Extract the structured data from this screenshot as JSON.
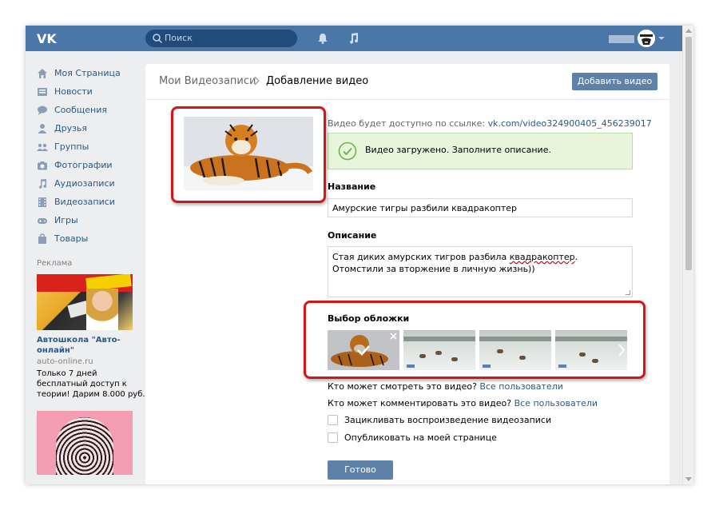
{
  "header": {
    "search_placeholder": "Поиск"
  },
  "sidebar": {
    "items": [
      {
        "label": "Моя Страница",
        "icon": "home-icon"
      },
      {
        "label": "Новости",
        "icon": "news-icon"
      },
      {
        "label": "Сообщения",
        "icon": "messages-icon"
      },
      {
        "label": "Друзья",
        "icon": "friends-icon"
      },
      {
        "label": "Группы",
        "icon": "groups-icon"
      },
      {
        "label": "Фотографии",
        "icon": "camera-icon"
      },
      {
        "label": "Аудиозаписи",
        "icon": "music-note-icon"
      },
      {
        "label": "Видеозаписи",
        "icon": "film-icon"
      },
      {
        "label": "Игры",
        "icon": "gamepad-icon"
      },
      {
        "label": "Товары",
        "icon": "shopping-bag-icon"
      }
    ],
    "ad_label": "Реклама",
    "ad": {
      "title": "Автошкола \"Авто-онлайн\"",
      "url": "auto-online.ru",
      "text": "Только 7 дней бесплатный доступ к теории! Дарим 8.000 руб."
    }
  },
  "breadcrumb": {
    "parent": "Мои Видеозаписи",
    "current": "Добавление видео"
  },
  "add_video_button": "Добавить видео",
  "video": {
    "link_prefix": "Видео будет доступно по ссылке: ",
    "link": "vk.com/video324900405_456239017",
    "status": "Видео загружено. Заполните описание."
  },
  "form": {
    "title_label": "Название",
    "title_value": "Амурские тигры разбили квадракоптер",
    "description_label": "Описание",
    "description_part1": "Стая диких амурских тигров разбила ",
    "description_misspelled": "квадракоптер",
    "description_part2": ". Отомстили за вторжение в личную жизнь))",
    "cover_label": "Выбор обложки",
    "view_privacy_label": "Кто может смотреть это видео?",
    "view_privacy_value": "Все пользователи",
    "comment_privacy_label": "Кто может комментировать это видео?",
    "comment_privacy_value": "Все пользователи",
    "loop_label": "Зацикливать воспроизведение видеозаписи",
    "publish_label": "Опубликовать на моей странице",
    "done_button": "Готово"
  },
  "colors": {
    "header": "#4a76a8",
    "link": "#2a5885",
    "button": "#5e81a8",
    "success_bg": "#e8f5db",
    "highlight": "#d2161a"
  }
}
